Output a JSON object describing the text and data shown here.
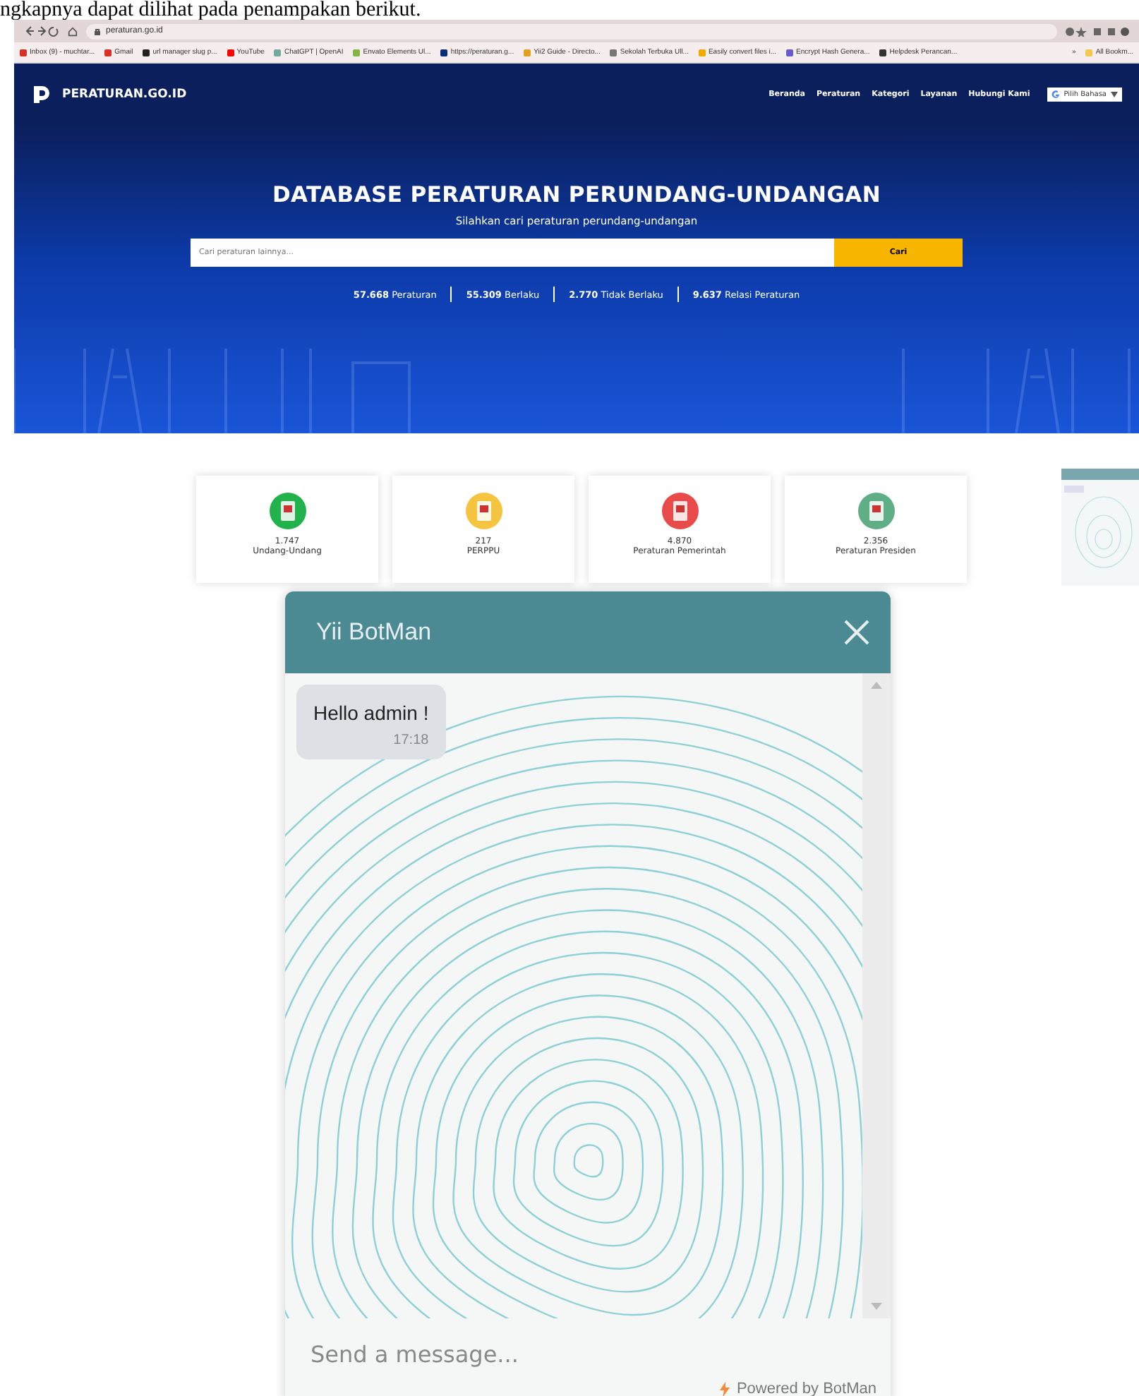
{
  "caption": "ngkapnya dapat dilihat pada penampakan berikut.",
  "browser": {
    "url": "peraturan.go.id",
    "bookmarks": [
      {
        "label": "Inbox (9) - muchtar...",
        "color": "#d93025"
      },
      {
        "label": "Gmail",
        "color": "#d93025"
      },
      {
        "label": "url manager slug p...",
        "color": "#222222"
      },
      {
        "label": "YouTube",
        "color": "#ff0000"
      },
      {
        "label": "ChatGPT | OpenAI",
        "color": "#74aa9c"
      },
      {
        "label": "Envato Elements Ul...",
        "color": "#82b541"
      },
      {
        "label": "https://peraturan.g...",
        "color": "#0b2a7a"
      },
      {
        "label": "Yii2 Guide - Directo...",
        "color": "#e0a020"
      },
      {
        "label": "Sekolah Terbuka Ull...",
        "color": "#777777"
      },
      {
        "label": "Easily convert files i...",
        "color": "#f2a900"
      },
      {
        "label": "Encrypt Hash Genera...",
        "color": "#6a5acd"
      },
      {
        "label": "Helpdesk Perancan...",
        "color": "#333333"
      }
    ],
    "overflow": "»",
    "all_bookmarks": "All Bookm..."
  },
  "site": {
    "logo": "PERATURAN.GO.ID",
    "nav": [
      "Beranda",
      "Peraturan",
      "Kategori",
      "Layanan",
      "Hubungi Kami"
    ],
    "language": "Pilih Bahasa",
    "title": "DATABASE PERATURAN PERUNDANG-UNDANGAN",
    "subtitle": "Silahkan cari peraturan perundang-undangan",
    "search": {
      "placeholder": "Cari peraturan lainnya...",
      "button": "Cari"
    },
    "stats": [
      {
        "value": "57.668",
        "label": "Peraturan"
      },
      {
        "value": "55.309",
        "label": "Berlaku"
      },
      {
        "value": "2.770",
        "label": "Tidak Berlaku"
      },
      {
        "value": "9.637",
        "label": "Relasi Peraturan"
      }
    ],
    "categories": [
      {
        "count": "1.747",
        "label": "Undang-Undang",
        "color": "#22b24c"
      },
      {
        "count": "217",
        "label": "PERPPU",
        "color": "#f5c542"
      },
      {
        "count": "4.870",
        "label": "Peraturan Pemerintah",
        "color": "#e94b4b"
      },
      {
        "count": "2.356",
        "label": "Peraturan Presiden",
        "color": "#5fae86"
      }
    ]
  },
  "chat": {
    "title": "Yii BotMan",
    "messages": [
      {
        "text": "Hello admin !",
        "time": "17:18"
      }
    ],
    "input": {
      "placeholder": "Send a message..."
    },
    "footer": "Powered by BotMan"
  }
}
